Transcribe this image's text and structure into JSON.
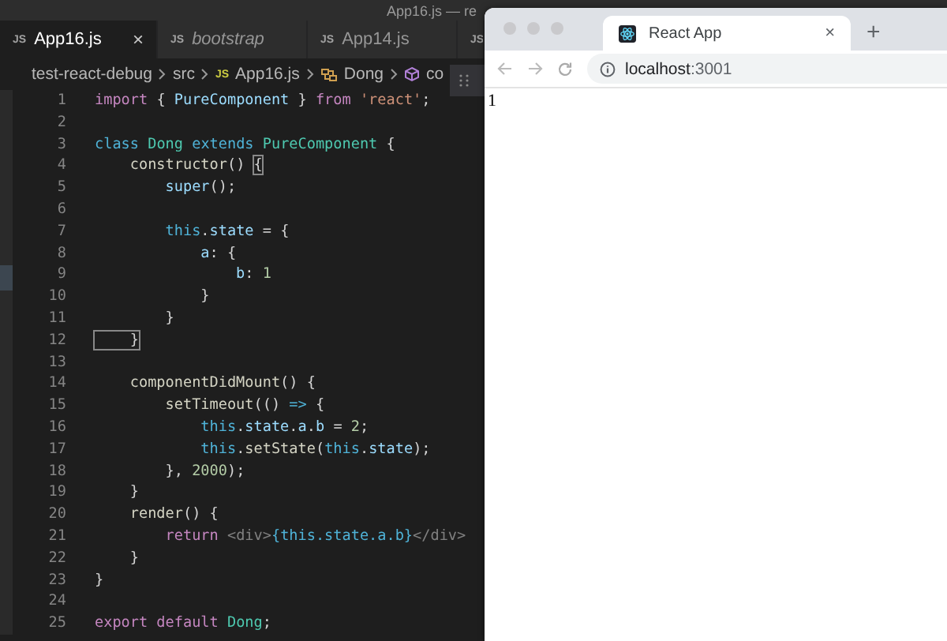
{
  "editor": {
    "title": "App16.js — re",
    "tabs": [
      {
        "icon": "JS",
        "label": "App16.js",
        "selected": true,
        "preview": false,
        "close": "×"
      },
      {
        "icon": "JS",
        "label": "bootstrap",
        "selected": false,
        "preview": true
      },
      {
        "icon": "JS",
        "label": "App14.js",
        "selected": false,
        "preview": false
      },
      {
        "icon": "JS",
        "selected": false
      }
    ],
    "breadcrumb": [
      {
        "kind": "folder",
        "label": "test-react-debug"
      },
      {
        "kind": "folder",
        "label": "src"
      },
      {
        "kind": "file",
        "icon": "JS",
        "label": "App16.js"
      },
      {
        "kind": "class",
        "label": "Dong"
      },
      {
        "kind": "method",
        "label": "co"
      }
    ],
    "code_lines": [
      {
        "number": "1",
        "tokens": [
          {
            "kind": "keyword",
            "text": "import"
          },
          {
            "kind": "plain",
            "text": " { "
          },
          {
            "kind": "var",
            "text": "PureComponent"
          },
          {
            "kind": "plain",
            "text": " } "
          },
          {
            "kind": "keyword",
            "text": "from "
          },
          {
            "kind": "string",
            "text": "'react'"
          },
          {
            "kind": "plain",
            "text": ";"
          }
        ]
      },
      {
        "number": "2"
      },
      {
        "number": "3",
        "tokens": [
          {
            "kind": "storage",
            "text": "class "
          },
          {
            "kind": "type",
            "text": "Dong "
          },
          {
            "kind": "storage",
            "text": "extends "
          },
          {
            "kind": "type",
            "text": "PureComponent"
          },
          {
            "kind": "plain",
            "text": " {"
          }
        ]
      },
      {
        "number": "4",
        "tokens": [
          {
            "kind": "func",
            "text": "    constructor"
          },
          {
            "kind": "plain",
            "text": "() "
          },
          {
            "kind": "bracket",
            "text": "{"
          }
        ]
      },
      {
        "number": "5",
        "tokens": [
          {
            "kind": "var",
            "text": "        super"
          },
          {
            "kind": "plain",
            "text": "();"
          }
        ]
      },
      {
        "number": "6"
      },
      {
        "number": "7",
        "tokens": [
          {
            "kind": "storage",
            "text": "        this"
          },
          {
            "kind": "plain",
            "text": "."
          },
          {
            "kind": "var",
            "text": "state"
          },
          {
            "kind": "plain",
            "text": " = {"
          }
        ]
      },
      {
        "number": "8",
        "tokens": [
          {
            "kind": "var",
            "text": "            a"
          },
          {
            "kind": "plain",
            "text": ": {"
          }
        ]
      },
      {
        "number": "9",
        "tokens": [
          {
            "kind": "var",
            "text": "                b"
          },
          {
            "kind": "plain",
            "text": ": "
          },
          {
            "kind": "number",
            "text": "1"
          }
        ]
      },
      {
        "number": "10",
        "tokens": [
          {
            "kind": "plain",
            "text": "            }"
          }
        ]
      },
      {
        "number": "11",
        "tokens": [
          {
            "kind": "plain",
            "text": "        }"
          }
        ]
      },
      {
        "number": "12",
        "tokens": [
          {
            "kind": "bracket",
            "text": "    }"
          }
        ]
      },
      {
        "number": "13"
      },
      {
        "number": "14",
        "tokens": [
          {
            "kind": "func",
            "text": "    componentDidMount"
          },
          {
            "kind": "plain",
            "text": "() {"
          }
        ]
      },
      {
        "number": "15",
        "tokens": [
          {
            "kind": "func",
            "text": "        setTimeout"
          },
          {
            "kind": "plain",
            "text": "(() "
          },
          {
            "kind": "storage",
            "text": "=>"
          },
          {
            "kind": "plain",
            "text": " {"
          }
        ]
      },
      {
        "number": "16",
        "tokens": [
          {
            "kind": "storage",
            "text": "            this"
          },
          {
            "kind": "plain",
            "text": "."
          },
          {
            "kind": "var",
            "text": "state"
          },
          {
            "kind": "plain",
            "text": "."
          },
          {
            "kind": "var",
            "text": "a"
          },
          {
            "kind": "plain",
            "text": "."
          },
          {
            "kind": "var",
            "text": "b"
          },
          {
            "kind": "plain",
            "text": " = "
          },
          {
            "kind": "number",
            "text": "2"
          },
          {
            "kind": "plain",
            "text": ";"
          }
        ]
      },
      {
        "number": "17",
        "tokens": [
          {
            "kind": "storage",
            "text": "            this"
          },
          {
            "kind": "plain",
            "text": "."
          },
          {
            "kind": "func",
            "text": "setState"
          },
          {
            "kind": "plain",
            "text": "("
          },
          {
            "kind": "storage",
            "text": "this"
          },
          {
            "kind": "plain",
            "text": "."
          },
          {
            "kind": "var",
            "text": "state"
          },
          {
            "kind": "plain",
            "text": ");"
          }
        ]
      },
      {
        "number": "18",
        "tokens": [
          {
            "kind": "plain",
            "text": "        }, "
          },
          {
            "kind": "number",
            "text": "2000"
          },
          {
            "kind": "plain",
            "text": ");"
          }
        ]
      },
      {
        "number": "19",
        "tokens": [
          {
            "kind": "plain",
            "text": "    }"
          }
        ]
      },
      {
        "number": "20",
        "tokens": [
          {
            "kind": "func",
            "text": "    render"
          },
          {
            "kind": "plain",
            "text": "() {"
          }
        ]
      },
      {
        "number": "21",
        "tokens": [
          {
            "kind": "keyword",
            "text": "        return "
          },
          {
            "kind": "tag",
            "text": "<div>"
          },
          {
            "kind": "storage",
            "text": "{this.state.a.b}"
          },
          {
            "kind": "tag",
            "text": "</div>"
          }
        ]
      },
      {
        "number": "22",
        "tokens": [
          {
            "kind": "plain",
            "text": "    }"
          }
        ]
      },
      {
        "number": "23",
        "tokens": [
          {
            "kind": "plain",
            "text": "}"
          }
        ]
      },
      {
        "number": "24"
      },
      {
        "number": "25",
        "tokens": [
          {
            "kind": "keyword",
            "text": "export default "
          },
          {
            "kind": "type",
            "text": "Dong"
          },
          {
            "kind": "plain",
            "text": ";"
          }
        ]
      }
    ]
  },
  "browser": {
    "tab": {
      "title": "React App",
      "close": "×"
    },
    "new_tab": "+",
    "address": "**localhost**:3001",
    "page_text": "1"
  }
}
